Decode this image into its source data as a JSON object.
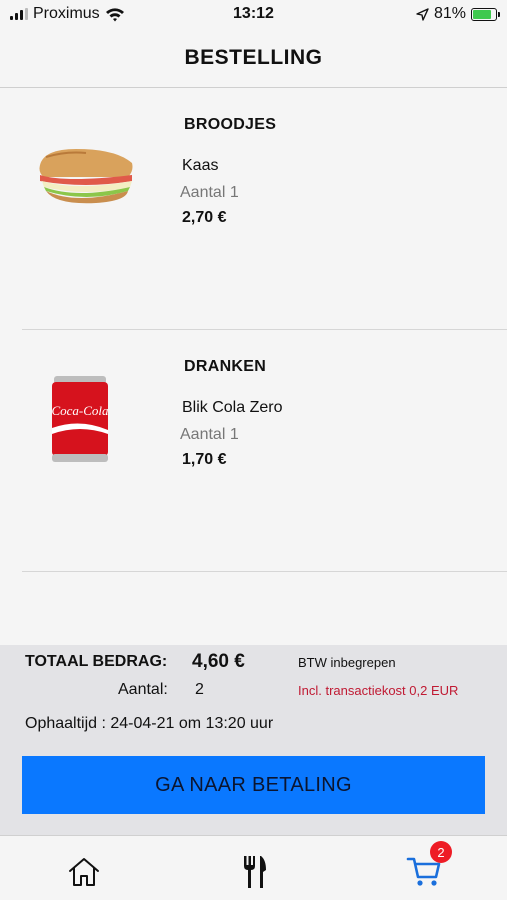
{
  "status_bar": {
    "carrier": "Proximus",
    "time": "13:12",
    "battery": "81%",
    "battery_level": 0.81,
    "icons": [
      "signal-icon",
      "wifi-icon",
      "location-arrow-icon",
      "battery-charging-icon"
    ]
  },
  "header": {
    "title": "BESTELLING"
  },
  "items": [
    {
      "category": "BROODJES",
      "name": "Kaas",
      "quantity": "Aantal 1",
      "price": "2,70 €",
      "image": "sandwich-image"
    },
    {
      "category": "DRANKEN",
      "name": "Blik Cola Zero",
      "quantity": "Aantal 1",
      "price": "1,70 €",
      "image": "cola-can-image",
      "image_text": "Coca-Cola"
    }
  ],
  "summary": {
    "total_label": "TOTAAL BEDRAG:",
    "total_value": "4,60 €",
    "vat_note": "BTW inbegrepen",
    "count_label": "Aantal:",
    "count_value": "2",
    "fee_note": "Incl. transactiekost 0,2 EUR",
    "pickup": "Ophaaltijd : 24-04-21 om 13:20 uur",
    "pay_button": "GA NAAR BETALING"
  },
  "tabbar": {
    "tabs": [
      "home-icon",
      "cutlery-icon",
      "cart-icon"
    ],
    "cart_badge": "2"
  },
  "colors": {
    "accent": "#0a78ff",
    "badge": "#ee1c25",
    "fee_text": "#c01a33",
    "cart_icon": "#1a6fdc",
    "summary_bg": "#e3e3e6"
  }
}
